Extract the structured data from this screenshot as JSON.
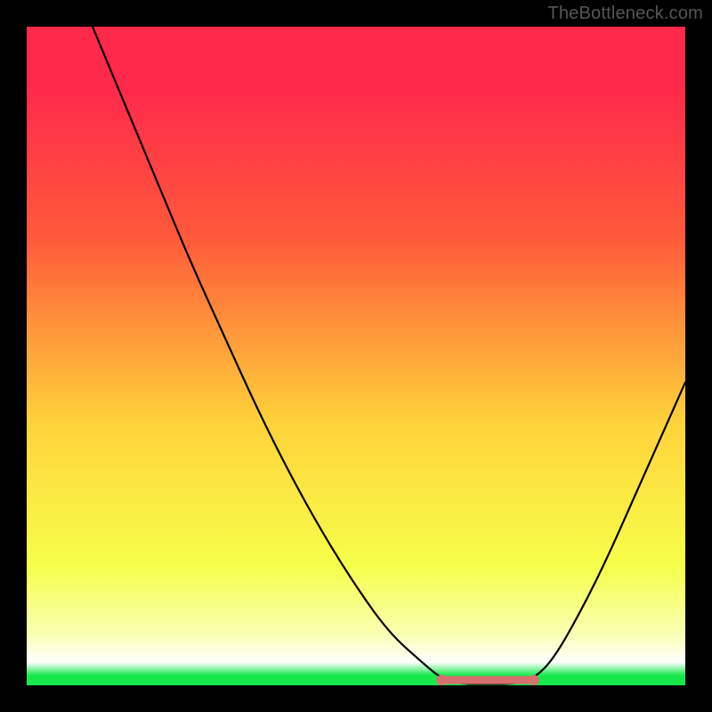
{
  "watermark": "TheBottleneck.com",
  "colors": {
    "black": "#000000",
    "gradient_top": "#ff2a4b",
    "gradient_upper": "#ff5a3a",
    "gradient_mid": "#ffd23a",
    "gradient_lower": "#f6ff4a",
    "gradient_pale": "#faffb0",
    "gradient_bottom": "#17e84c",
    "curve": "#000000",
    "marker": "#d87070"
  },
  "chart_data": {
    "type": "line",
    "title": "",
    "xlabel": "",
    "ylabel": "",
    "xlim": [
      0,
      100
    ],
    "ylim": [
      0,
      100
    ],
    "curve": [
      {
        "x": 10,
        "y": 100
      },
      {
        "x": 15,
        "y": 88
      },
      {
        "x": 20,
        "y": 76
      },
      {
        "x": 25,
        "y": 64
      },
      {
        "x": 30,
        "y": 53
      },
      {
        "x": 35,
        "y": 42
      },
      {
        "x": 40,
        "y": 32
      },
      {
        "x": 45,
        "y": 23
      },
      {
        "x": 50,
        "y": 15
      },
      {
        "x": 55,
        "y": 8
      },
      {
        "x": 60,
        "y": 3.5
      },
      {
        "x": 63,
        "y": 1
      },
      {
        "x": 66,
        "y": 0.2
      },
      {
        "x": 70,
        "y": 0.2
      },
      {
        "x": 74,
        "y": 0.2
      },
      {
        "x": 77,
        "y": 1
      },
      {
        "x": 80,
        "y": 4
      },
      {
        "x": 84,
        "y": 11
      },
      {
        "x": 88,
        "y": 19
      },
      {
        "x": 92,
        "y": 28
      },
      {
        "x": 96,
        "y": 37
      },
      {
        "x": 100,
        "y": 46
      }
    ],
    "flat_segment": {
      "x_start": 63,
      "x_end": 77,
      "y": 0.8
    },
    "markers": [
      {
        "x": 63,
        "y": 0.8
      },
      {
        "x": 77,
        "y": 0.8
      }
    ],
    "gradient_stops": [
      {
        "offset": 0.0,
        "y": 100
      },
      {
        "offset": 0.25,
        "y": 75
      },
      {
        "offset": 0.55,
        "y": 45
      },
      {
        "offset": 0.82,
        "y": 18
      },
      {
        "offset": 0.92,
        "y": 8
      },
      {
        "offset": 1.0,
        "y": 0
      }
    ]
  }
}
